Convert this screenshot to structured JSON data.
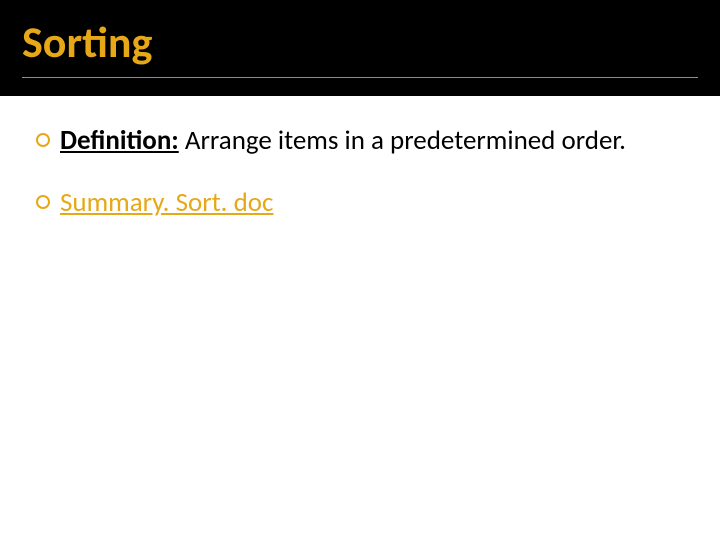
{
  "title": "Sorting",
  "items": [
    {
      "label": "Definition:",
      "text": " Arrange items in a predetermined order."
    },
    {
      "link": "Summary. Sort. doc"
    }
  ]
}
